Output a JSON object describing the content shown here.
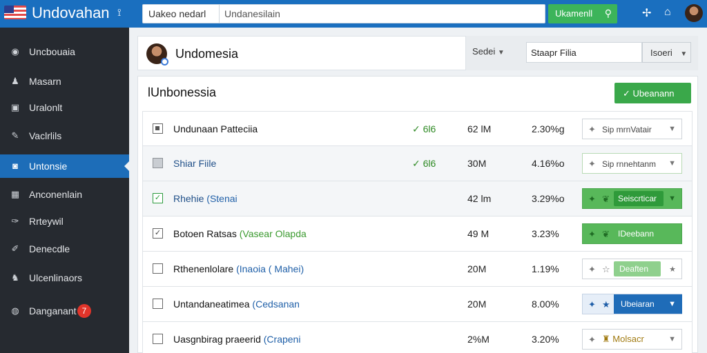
{
  "topbar": {
    "brand": "Undovahan",
    "search_category": "Uakeo nedarl",
    "search_value": "Undanesilain",
    "search_button": "Ukamenll"
  },
  "sidebar": {
    "items": [
      {
        "label": "Uncbouaia",
        "icon": "gauge-icon"
      },
      {
        "label": "Masarn",
        "icon": "user-icon"
      },
      {
        "label": "Uralonlt",
        "icon": "clipboard-icon"
      },
      {
        "label": "Vaclrlils",
        "icon": "pencil-icon"
      },
      {
        "label": "Untonsie",
        "icon": "chat-icon",
        "active": true
      },
      {
        "label": "Anconenlain",
        "icon": "building-icon"
      },
      {
        "label": "Rrteywil",
        "icon": "wrench-icon"
      },
      {
        "label": "Denecdle",
        "icon": "pin-icon"
      },
      {
        "label": "Ulcenlinaors",
        "icon": "users-icon"
      },
      {
        "label": "Danganant",
        "icon": "globe-icon",
        "badge": "7"
      }
    ]
  },
  "header": {
    "title": "Undomesia",
    "sort_label": "Sedei",
    "file_value": "Staapr Filia",
    "filter_label": "Isoeri"
  },
  "panel": {
    "title": "lUnbonessia",
    "primary_button": "Ubeanann"
  },
  "rows": [
    {
      "name": "Undunaan Patteciia",
      "sub": "",
      "status": "6l6",
      "size": "62 lM",
      "pct": "2.30%g",
      "action": "Sip mrnVatair"
    },
    {
      "name": "Shiar Fiile",
      "sub": "",
      "status": "6l6",
      "size": "30M",
      "pct": "4.16%o",
      "action": "Sip rnnehtanm"
    },
    {
      "name": "Rhehie",
      "sub": "Stenai",
      "status": "",
      "size": "42 lm",
      "pct": "3.29%o",
      "action": "Seiscrticar"
    },
    {
      "name": "Botoen Ratsas",
      "sub": "Vasear Olapda",
      "status": "",
      "size": "49 M",
      "pct": "3.23%",
      "action": "IDeebann"
    },
    {
      "name": "Rthenenlolare",
      "sub": "Inaoia ( Mahei",
      "status": "",
      "size": "20M",
      "pct": "1.19%",
      "action": "Deaften"
    },
    {
      "name": "Untandaneatimea",
      "sub": "Cedsanan",
      "status": "",
      "size": "20M",
      "pct": "8.00%",
      "action": "Ubeiaran"
    },
    {
      "name": "Uasgnbirag praeerid",
      "sub": "Crapeni",
      "status": "",
      "size": "2%M",
      "pct": "3.20%",
      "action": "Molsacr"
    }
  ]
}
